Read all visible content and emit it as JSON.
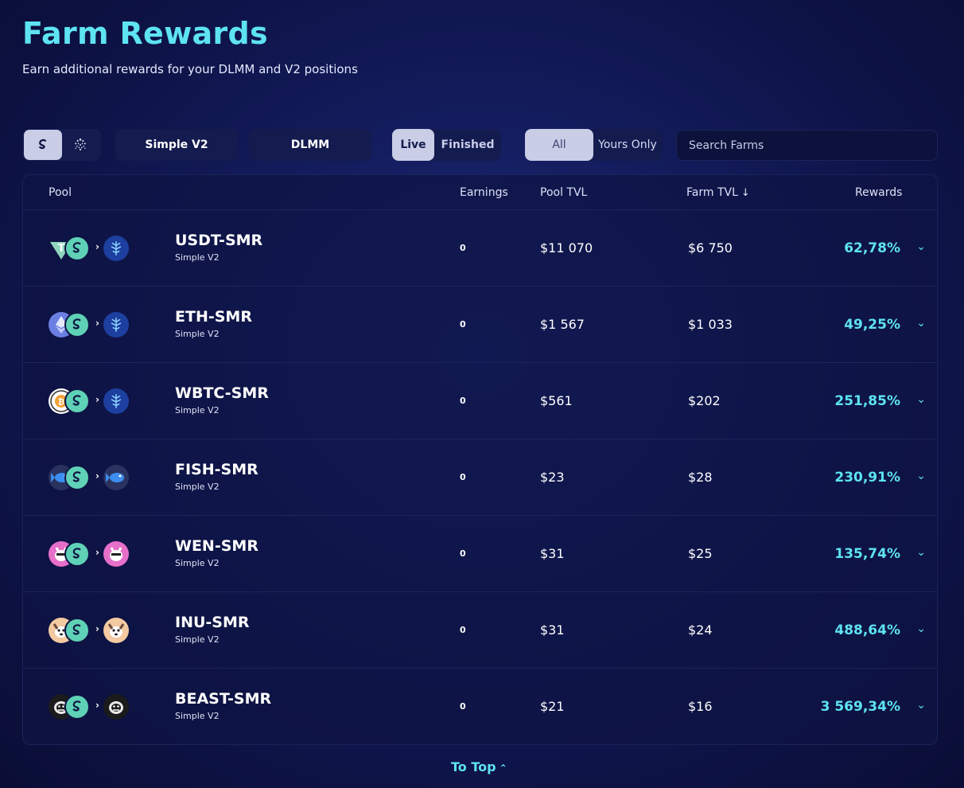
{
  "header": {
    "title": "Farm Rewards",
    "subtitle": "Earn additional rewards for your DLMM and V2 positions"
  },
  "toolbar": {
    "chains": [
      {
        "name": "shimmer",
        "icon": "shimmer-icon",
        "active": true
      },
      {
        "name": "iota",
        "icon": "iota-icon",
        "active": false
      }
    ],
    "version_tabs": [
      "Simple V2",
      "DLMM"
    ],
    "status_tabs": {
      "live": "Live",
      "finished": "Finished",
      "active": "Live"
    },
    "ownership_tabs": {
      "all": "All",
      "yours": "Yours Only",
      "active": "All"
    },
    "search": {
      "placeholder": "Search Farms",
      "value": ""
    }
  },
  "table": {
    "headers": {
      "pool": "Pool",
      "earnings": "Earnings",
      "pool_tvl": "Pool TVL",
      "farm_tvl": "Farm TVL",
      "farm_tvl_sort": "↓",
      "rewards": "Rewards"
    },
    "rows": [
      {
        "pair": "USDT-SMR",
        "type": "Simple V2",
        "earnings": "0",
        "pool_tvl": "$11 070",
        "farm_tvl": "$6 750",
        "rewards": "62,78%",
        "base_icon": "usdt-icon",
        "reward_icon": "reward-token-icon"
      },
      {
        "pair": "ETH-SMR",
        "type": "Simple V2",
        "earnings": "0",
        "pool_tvl": "$1 567",
        "farm_tvl": "$1 033",
        "rewards": "49,25%",
        "base_icon": "eth-icon",
        "reward_icon": "reward-token-icon"
      },
      {
        "pair": "WBTC-SMR",
        "type": "Simple V2",
        "earnings": "0",
        "pool_tvl": "$561",
        "farm_tvl": "$202",
        "rewards": "251,85%",
        "base_icon": "wbtc-icon",
        "reward_icon": "reward-token-icon"
      },
      {
        "pair": "FISH-SMR",
        "type": "Simple V2",
        "earnings": "0",
        "pool_tvl": "$23",
        "farm_tvl": "$28",
        "rewards": "230,91%",
        "base_icon": "fish-icon",
        "reward_icon": "fish-icon"
      },
      {
        "pair": "WEN-SMR",
        "type": "Simple V2",
        "earnings": "0",
        "pool_tvl": "$31",
        "farm_tvl": "$25",
        "rewards": "135,74%",
        "base_icon": "wen-icon",
        "reward_icon": "wen-icon"
      },
      {
        "pair": "INU-SMR",
        "type": "Simple V2",
        "earnings": "0",
        "pool_tvl": "$31",
        "farm_tvl": "$24",
        "rewards": "488,64%",
        "base_icon": "inu-icon",
        "reward_icon": "inu-icon"
      },
      {
        "pair": "BEAST-SMR",
        "type": "Simple V2",
        "earnings": "0",
        "pool_tvl": "$21",
        "farm_tvl": "$16",
        "rewards": "3 569,34%",
        "base_icon": "beast-icon",
        "reward_icon": "beast-icon"
      }
    ]
  },
  "footer": {
    "to_top": "To Top",
    "caret": "⌃"
  },
  "colors": {
    "accent": "#5ee3f2",
    "smr": "#5fd1b6",
    "reward_token": "#1d3fa0",
    "background": "#121a58"
  }
}
